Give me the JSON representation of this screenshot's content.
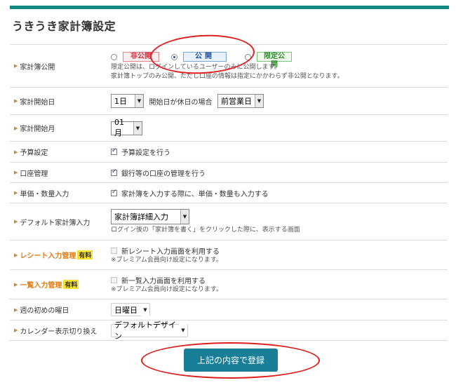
{
  "page": {
    "title": "うきうき家計簿設定"
  },
  "visibility": {
    "label": "家計簿公開",
    "options": [
      {
        "label": "非公開",
        "selected": false
      },
      {
        "label": "公開",
        "selected": true
      },
      {
        "label": "限定公開",
        "selected": false
      }
    ],
    "note_lines": [
      "限定公開は、ログインしているユーザーのみに公開します。",
      "家計簿トップのみ公開、ただし口座の情報は指定にかかわらず非公開となります。"
    ]
  },
  "start_day": {
    "label": "家計開始日",
    "value": "1日",
    "holiday_label": "開始日が休日の場合",
    "holiday_value": "前営業日"
  },
  "start_month": {
    "label": "家計開始月",
    "value": "01月"
  },
  "budget": {
    "label": "予算設定",
    "checkbox_label": "予算設定を行う",
    "checked": true
  },
  "accounts": {
    "label": "口座管理",
    "checkbox_label": "銀行等の口座の管理を行う",
    "checked": true
  },
  "unit_price": {
    "label": "単価・数量入力",
    "checkbox_label": "家計簿を入力する際に、単価・数量も入力する",
    "checked": true
  },
  "default_input": {
    "label": "デフォルト家計簿入力",
    "value": "家計簿詳細入力",
    "note": "ログイン後の「家計簿を書く」をクリックした際に、表示する画面"
  },
  "receipt": {
    "label": "レシート入力管理",
    "badge": "有料",
    "checkbox_label": "新レシート入力画面を利用する",
    "note": "※プレミアム会員向け設定になります。",
    "checked": false
  },
  "list_input": {
    "label": "一覧入力管理",
    "badge": "有料",
    "checkbox_label": "新一覧入力画面を利用する",
    "note": "※プレミアム会員向け設定になります。",
    "checked": false
  },
  "week_start": {
    "label": "週の初めの曜日",
    "value": "日曜日"
  },
  "calendar": {
    "label": "カレンダー表示切り換え",
    "value": "デフォルトデザイン"
  },
  "submit": {
    "label": "上記の内容で登録"
  },
  "colors": {
    "accent": "#0f8a82",
    "button": "#197f99",
    "annotation": "#e01e1e",
    "paid_badge": "#f7e12a",
    "paid_label": "#e07a10"
  },
  "icons": {
    "row_marker": "triangle-right-icon",
    "dropdown": "chevron-down-icon"
  }
}
